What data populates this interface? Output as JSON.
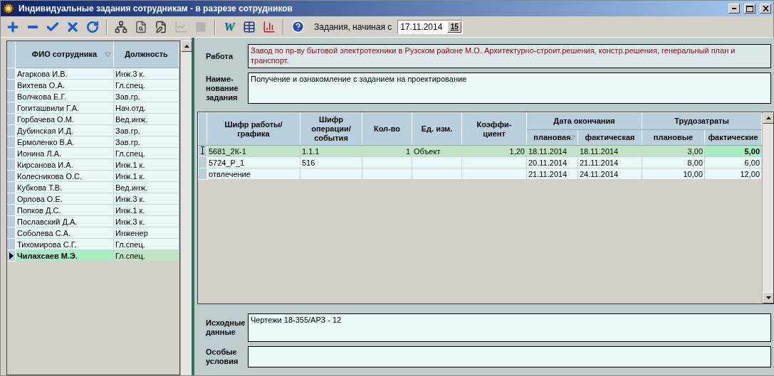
{
  "window": {
    "title": "Индивидуальные задания сотрудникам  - в разрезе сотрудников"
  },
  "toolbar": {
    "buttons": [
      {
        "kind": "add",
        "disabled": false
      },
      {
        "kind": "remove",
        "disabled": false
      },
      {
        "kind": "confirm",
        "disabled": false
      },
      {
        "kind": "cancel",
        "disabled": false
      },
      {
        "kind": "refresh",
        "disabled": false
      },
      {
        "kind": "separator"
      },
      {
        "kind": "tree",
        "disabled": false
      },
      {
        "kind": "preview",
        "disabled": false
      },
      {
        "kind": "edit",
        "disabled": false
      },
      {
        "kind": "graph",
        "disabled": true
      },
      {
        "kind": "block",
        "disabled": true
      },
      {
        "kind": "separator"
      },
      {
        "kind": "letter",
        "glyph": "W",
        "disabled": false
      },
      {
        "kind": "table",
        "disabled": false
      },
      {
        "kind": "chart",
        "disabled": false
      },
      {
        "kind": "separator"
      },
      {
        "kind": "help",
        "disabled": false
      }
    ],
    "date_label": "Задания, начиная с",
    "date_value": "17.11.2014",
    "calendar_button": "15"
  },
  "employees": {
    "columns": [
      {
        "label": "ФИО сотрудника",
        "sorted": true
      },
      {
        "label": "Должность",
        "sorted": false
      }
    ],
    "rows": [
      {
        "name": "Агаркова И.В.",
        "position": "Инж.3 к.",
        "selected": false
      },
      {
        "name": "Вихтева О.А.",
        "position": "Гл.спец.",
        "selected": false
      },
      {
        "name": "Волчкова Е.Г.",
        "position": "Зав.гр.",
        "selected": false
      },
      {
        "name": "Гогиташвили Г.А.",
        "position": "Нач.отд.",
        "selected": false
      },
      {
        "name": "Горбачева О.М.",
        "position": "Вед.инж.",
        "selected": false
      },
      {
        "name": "Дубинская И.Д.",
        "position": "Зав.гр.",
        "selected": false
      },
      {
        "name": "Ермоленко В.А.",
        "position": "Зав.гр.",
        "selected": false
      },
      {
        "name": "Ионина Л.А.",
        "position": "Гл.спец.",
        "selected": false
      },
      {
        "name": "Кирсанова И.А.",
        "position": "Инж.1 к.",
        "selected": false
      },
      {
        "name": "Колесникова О.С.",
        "position": "Инж.1 к.",
        "selected": false
      },
      {
        "name": "Кубкова Т.В.",
        "position": "Вед.инж.",
        "selected": false
      },
      {
        "name": "Орлова О.Е.",
        "position": "Инж.3 к.",
        "selected": false
      },
      {
        "name": "Попков Д.С.",
        "position": "Инж.1 к.",
        "selected": false
      },
      {
        "name": "Пославский Д.А.",
        "position": "Инж.3 к.",
        "selected": false
      },
      {
        "name": "Соболева С.А.",
        "position": "Инженер",
        "selected": false
      },
      {
        "name": "Тихомирова С.Г.",
        "position": "Гл.спец.",
        "selected": false
      },
      {
        "name": "Чилахсаев М.Э.",
        "position": "Гл.спец.",
        "selected": true
      }
    ]
  },
  "work": {
    "label": "Работа",
    "value": "Завод по пр-ву бытовой электротехники в Рузском районе М.О. Архитектурно-строит.решения, констр.решения, генеральный план и транспорт."
  },
  "task_name": {
    "label": "Наиме-\nнование\nзадания",
    "value": "Получение и ознакомление с заданием на проектирование"
  },
  "tasks": {
    "columns": [
      {
        "label": "Шифр работы/\nграфика",
        "sorted": false
      },
      {
        "label": "Шифр\nоперации/\nсобытия",
        "sorted": false
      },
      {
        "label": "Кол-во",
        "sorted": false
      },
      {
        "label": "Ед. изм.",
        "sorted": false
      },
      {
        "label": "Коэффи-\nциент",
        "sorted": false
      }
    ],
    "groups": [
      {
        "label": "Дата окончания",
        "columns": [
          {
            "label": "плановая",
            "sorted": true
          },
          {
            "label": "фактическая",
            "sorted": false
          }
        ]
      },
      {
        "label": "Трудозатраты",
        "columns": [
          {
            "label": "плановые",
            "sorted": false
          },
          {
            "label": "фактические",
            "sorted": false
          }
        ]
      }
    ],
    "rows": [
      {
        "cells": [
          "5681_2К-1",
          "1.1.1",
          "1",
          "Объект",
          "1,20",
          "18.11.2014",
          "18.11.2014",
          "3,00",
          "5,00"
        ],
        "selected": true
      },
      {
        "cells": [
          "5724_Р_1",
          "516",
          "",
          "",
          "",
          "20.11.2014",
          "21.11.2014",
          "8,00",
          "6,00"
        ],
        "selected": false
      },
      {
        "cells": [
          "отвлечение",
          "",
          "",
          "",
          "",
          "21.11.2014",
          "24.11.2014",
          "10,00",
          "12,00"
        ],
        "selected": false
      }
    ]
  },
  "source_data": {
    "label": "Исходные\nданные",
    "value": "Чертежи 18-355/АРЗ - 12"
  },
  "special_conditions": {
    "label": "Особые\nусловия"
  }
}
